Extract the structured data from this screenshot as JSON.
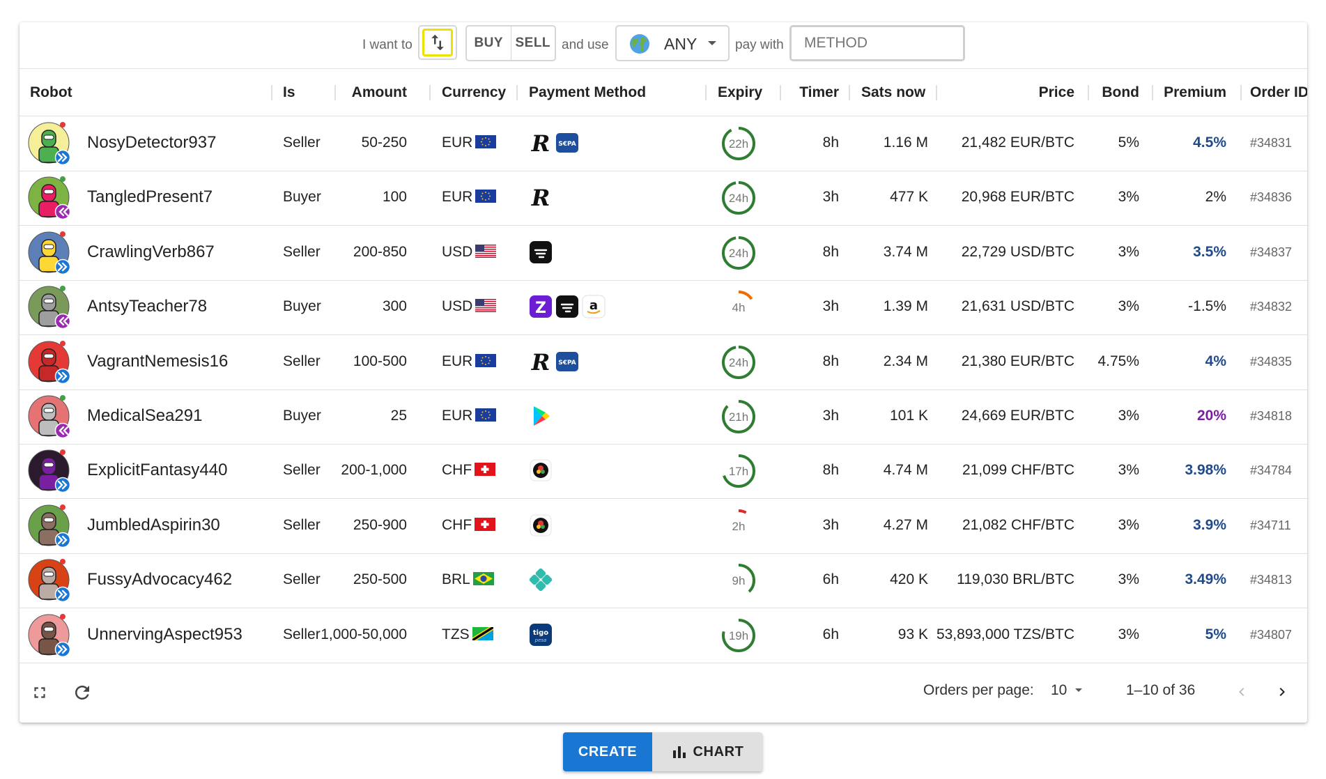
{
  "toolbar": {
    "i_want_to": "I want to",
    "buy": "BUY",
    "sell": "SELL",
    "and_use": "and use",
    "currency": "ANY",
    "pay_with": "pay with",
    "method_placeholder": "METHOD"
  },
  "headers": {
    "robot": "Robot",
    "is": "Is",
    "amount": "Amount",
    "currency": "Currency",
    "payment": "Payment Method",
    "expiry": "Expiry",
    "timer": "Timer",
    "sats": "Sats now",
    "price": "Price",
    "bond": "Bond",
    "premium": "Premium",
    "order_id": "Order ID"
  },
  "rows": [
    {
      "robot": "NosyDetector937",
      "is": "Seller",
      "amount": "50-250",
      "currency": "EUR",
      "expiry": "22h",
      "expiry_frac": 0.92,
      "expiry_color": "#2e7d32",
      "timer": "8h",
      "sats": "1.16 M",
      "price": "21,482 EUR/BTC",
      "bond": "5%",
      "premium": "4.5%",
      "premium_color": "#1f4b8c",
      "premium_bold": true,
      "order_id": "#34831"
    },
    {
      "robot": "TangledPresent7",
      "is": "Buyer",
      "amount": "100",
      "currency": "EUR",
      "expiry": "24h",
      "expiry_frac": 0.97,
      "expiry_color": "#2e7d32",
      "timer": "3h",
      "sats": "477 K",
      "price": "20,968 EUR/BTC",
      "bond": "3%",
      "premium": "2%",
      "premium_color": "#222222",
      "premium_bold": false,
      "order_id": "#34836"
    },
    {
      "robot": "CrawlingVerb867",
      "is": "Seller",
      "amount": "200-850",
      "currency": "USD",
      "expiry": "24h",
      "expiry_frac": 0.97,
      "expiry_color": "#2e7d32",
      "timer": "8h",
      "sats": "3.74 M",
      "price": "22,729 USD/BTC",
      "bond": "3%",
      "premium": "3.5%",
      "premium_color": "#1f4b8c",
      "premium_bold": true,
      "order_id": "#34837"
    },
    {
      "robot": "AntsyTeacher78",
      "is": "Buyer",
      "amount": "300",
      "currency": "USD",
      "expiry": "4h",
      "expiry_frac": 0.16,
      "expiry_color": "#ef6c00",
      "timer": "3h",
      "sats": "1.39 M",
      "price": "21,631 USD/BTC",
      "bond": "3%",
      "premium": "-1.5%",
      "premium_color": "#222222",
      "premium_bold": false,
      "order_id": "#34832"
    },
    {
      "robot": "VagrantNemesis16",
      "is": "Seller",
      "amount": "100-500",
      "currency": "EUR",
      "expiry": "24h",
      "expiry_frac": 0.97,
      "expiry_color": "#2e7d32",
      "timer": "8h",
      "sats": "2.34 M",
      "price": "21,380 EUR/BTC",
      "bond": "4.75%",
      "premium": "4%",
      "premium_color": "#1f4b8c",
      "premium_bold": true,
      "order_id": "#34835"
    },
    {
      "robot": "MedicalSea291",
      "is": "Buyer",
      "amount": "25",
      "currency": "EUR",
      "expiry": "21h",
      "expiry_frac": 0.87,
      "expiry_color": "#2e7d32",
      "timer": "3h",
      "sats": "101 K",
      "price": "24,669 EUR/BTC",
      "bond": "3%",
      "premium": "20%",
      "premium_color": "#7b1fa2",
      "premium_bold": true,
      "order_id": "#34818"
    },
    {
      "robot": "ExplicitFantasy440",
      "is": "Seller",
      "amount": "200-1,000",
      "currency": "CHF",
      "expiry": "17h",
      "expiry_frac": 0.7,
      "expiry_color": "#2e7d32",
      "timer": "8h",
      "sats": "4.74 M",
      "price": "21,099 CHF/BTC",
      "bond": "3%",
      "premium": "3.98%",
      "premium_color": "#1f4b8c",
      "premium_bold": true,
      "order_id": "#34784"
    },
    {
      "robot": "JumbledAspirin30",
      "is": "Seller",
      "amount": "250-900",
      "currency": "CHF",
      "expiry": "2h",
      "expiry_frac": 0.08,
      "expiry_color": "#d32f2f",
      "timer": "3h",
      "sats": "4.27 M",
      "price": "21,082 CHF/BTC",
      "bond": "3%",
      "premium": "3.9%",
      "premium_color": "#1f4b8c",
      "premium_bold": true,
      "order_id": "#34711"
    },
    {
      "robot": "FussyAdvocacy462",
      "is": "Seller",
      "amount": "250-500",
      "currency": "BRL",
      "expiry": "9h",
      "expiry_frac": 0.38,
      "expiry_color": "#2e7d32",
      "timer": "6h",
      "sats": "420 K",
      "price": "119,030 BRL/BTC",
      "bond": "3%",
      "premium": "3.49%",
      "premium_color": "#1f4b8c",
      "premium_bold": true,
      "order_id": "#34813"
    },
    {
      "robot": "UnnervingAspect953",
      "is": "Seller",
      "amount": "1,000-50,000",
      "currency": "TZS",
      "expiry": "19h",
      "expiry_frac": 0.79,
      "expiry_color": "#2e7d32",
      "timer": "6h",
      "sats": "93 K",
      "price": "53,893,000 TZS/BTC",
      "bond": "3%",
      "premium": "5%",
      "premium_color": "#1f4b8c",
      "premium_bold": true,
      "order_id": "#34807"
    }
  ],
  "footer": {
    "orders_per_page_label": "Orders per page:",
    "orders_per_page": "10",
    "range": "1–10 of 36"
  },
  "bottom": {
    "create": "CREATE",
    "chart": "CHART"
  },
  "colors": {
    "accent": "#1976d2",
    "seller_badge": "#1976d2",
    "buyer_badge": "#9c27b0"
  }
}
